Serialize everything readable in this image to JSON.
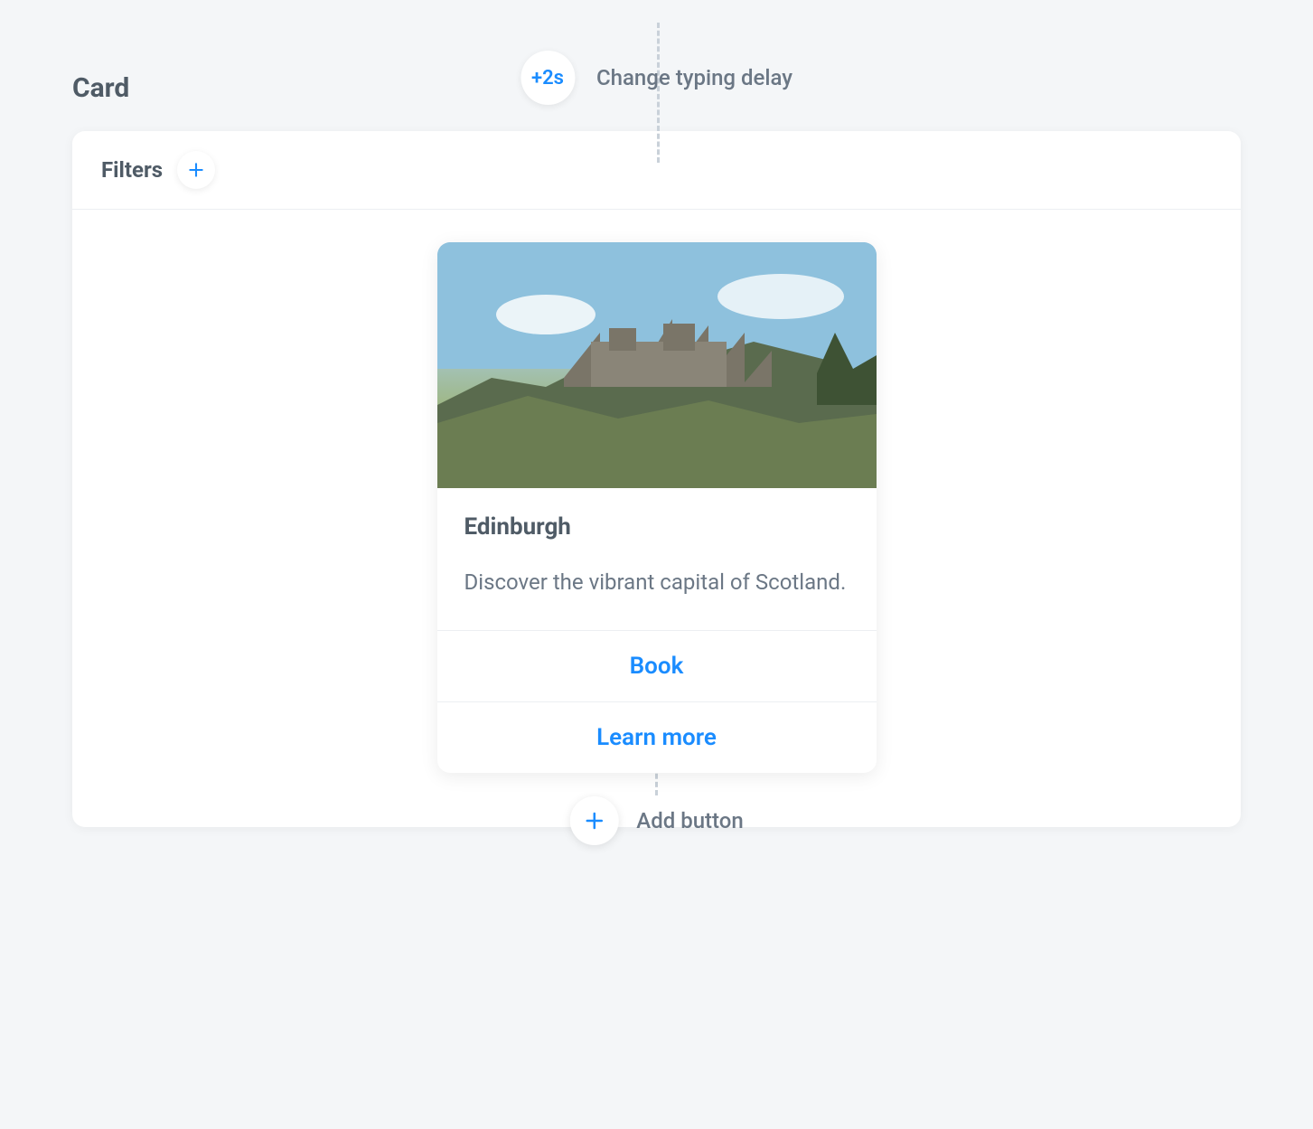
{
  "section_title": "Card",
  "typing_delay": {
    "pill": "+2s",
    "label": "Change typing delay"
  },
  "filters": {
    "label": "Filters"
  },
  "preview_card": {
    "title": "Edinburgh",
    "description": "Discover the vibrant capital of Scotland.",
    "actions": [
      {
        "label": "Book"
      },
      {
        "label": "Learn more"
      }
    ]
  },
  "add_button": {
    "label": "Add button"
  }
}
